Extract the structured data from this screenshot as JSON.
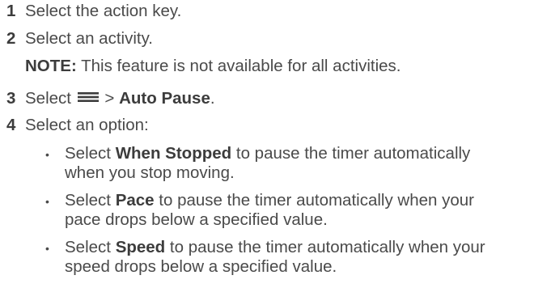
{
  "steps": [
    {
      "number": "1",
      "text": "Select the action key."
    },
    {
      "number": "2",
      "text": "Select an activity."
    },
    {
      "number": "3",
      "prefix": "Select",
      "icon": "menu-icon",
      "sep": ">",
      "bold": "Auto Pause",
      "suffix": "."
    },
    {
      "number": "4",
      "text": "Select an option:"
    }
  ],
  "note": {
    "label": "NOTE:",
    "text": "This feature is not available for all activities."
  },
  "options": [
    {
      "pre": "Select",
      "bold": "When Stopped",
      "line1": "to pause the timer automatically",
      "line2": "when you stop moving."
    },
    {
      "pre": "Select",
      "bold": "Pace",
      "line1": "to pause the timer automatically when your",
      "line2": "pace drops below a specified value."
    },
    {
      "pre": "Select",
      "bold": "Speed",
      "line1": "to pause the timer automatically when your",
      "line2": "speed drops below a specified value."
    }
  ],
  "bullet_char": "•"
}
